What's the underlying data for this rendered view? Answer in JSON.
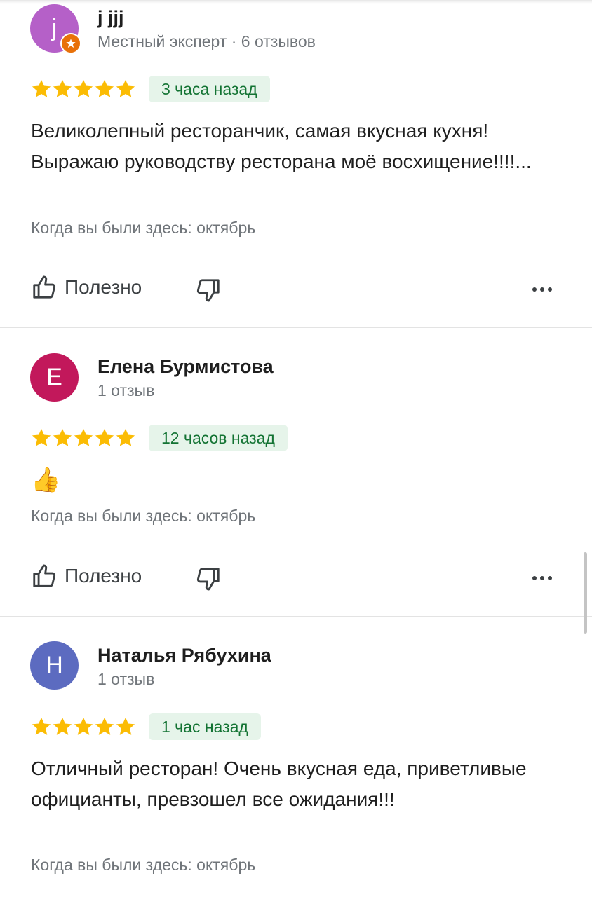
{
  "reviews": [
    {
      "avatar_letter": "j",
      "avatar_color": "#b560c8",
      "has_local_guide_badge": true,
      "name": "j jjj",
      "meta": "Местный эксперт · 6 отзывов",
      "rating": 5,
      "time": "3 часа назад",
      "text": "Великолепный ресторанчик, самая вкусная кухня! Выражаю руководству ресторана моё восхищение!!!!...",
      "visit": "Когда вы были здесь: октябрь",
      "useful_label": "Полезно"
    },
    {
      "avatar_letter": "Е",
      "avatar_color": "#c2185b",
      "has_local_guide_badge": false,
      "name": "Елена Бурмистова",
      "meta": "1 отзыв",
      "rating": 5,
      "time": "12 часов назад",
      "text": "👍",
      "visit": "Когда вы были здесь: октябрь",
      "useful_label": "Полезно"
    },
    {
      "avatar_letter": "Н",
      "avatar_color": "#5c6bc0",
      "has_local_guide_badge": false,
      "name": "Наталья Рябухина",
      "meta": "1 отзыв",
      "rating": 5,
      "time": "1 час назад",
      "text": "Отличный ресторан! Очень вкусная еда, приветливые официанты, превзошел все ожидания!!!",
      "visit": "Когда вы были здесь: октябрь",
      "useful_label": "Полезно"
    }
  ],
  "colors": {
    "star": "#fbbc04",
    "time_bg": "#e6f4ea",
    "time_text": "#137333"
  },
  "icons": [
    "thumb-up-icon",
    "thumb-down-icon",
    "more-horizontal-icon",
    "local-guide-star-icon",
    "star-icon"
  ]
}
